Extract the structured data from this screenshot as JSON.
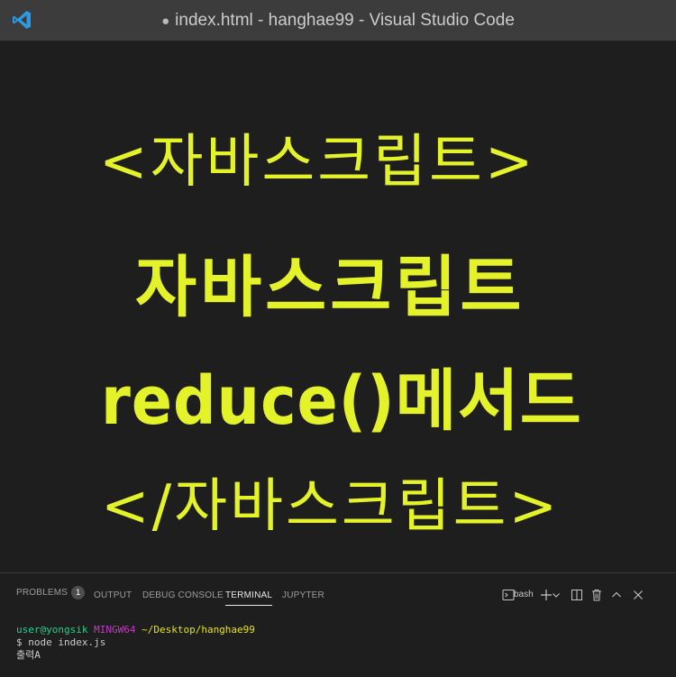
{
  "window": {
    "dirty_marker": "●",
    "title": "index.html - hanghae99 - Visual Studio Code",
    "logo_icon": "vscode-logo-icon"
  },
  "poster": {
    "line1": "<자바스크립트>",
    "line2": "자바스크립트",
    "line3": "reduce()메서드",
    "line4": "</자바스크립트>",
    "text_color": "#e4f22a"
  },
  "panel": {
    "tabs": [
      {
        "label": "PROBLEMS",
        "badge": "1"
      },
      {
        "label": "OUTPUT"
      },
      {
        "label": "DEBUG CONSOLE"
      },
      {
        "label": "TERMINAL",
        "active": true
      },
      {
        "label": "JUPYTER"
      }
    ],
    "actions": {
      "shell": "bash",
      "icons": [
        "terminal-icon",
        "plus-icon",
        "chevron-down-icon",
        "split-icon",
        "trash-icon",
        "chevron-up-icon",
        "close-icon"
      ]
    }
  },
  "terminal": {
    "user": "user@yongsik",
    "env": "MINGW64",
    "path": "~/Desktop/hanghae99",
    "command": "$ node index.js",
    "output": "출력A"
  },
  "colors": {
    "background": "#1e1e1e",
    "titlebar": "#3c3c3c",
    "accent_blue": "#0a7acc"
  }
}
